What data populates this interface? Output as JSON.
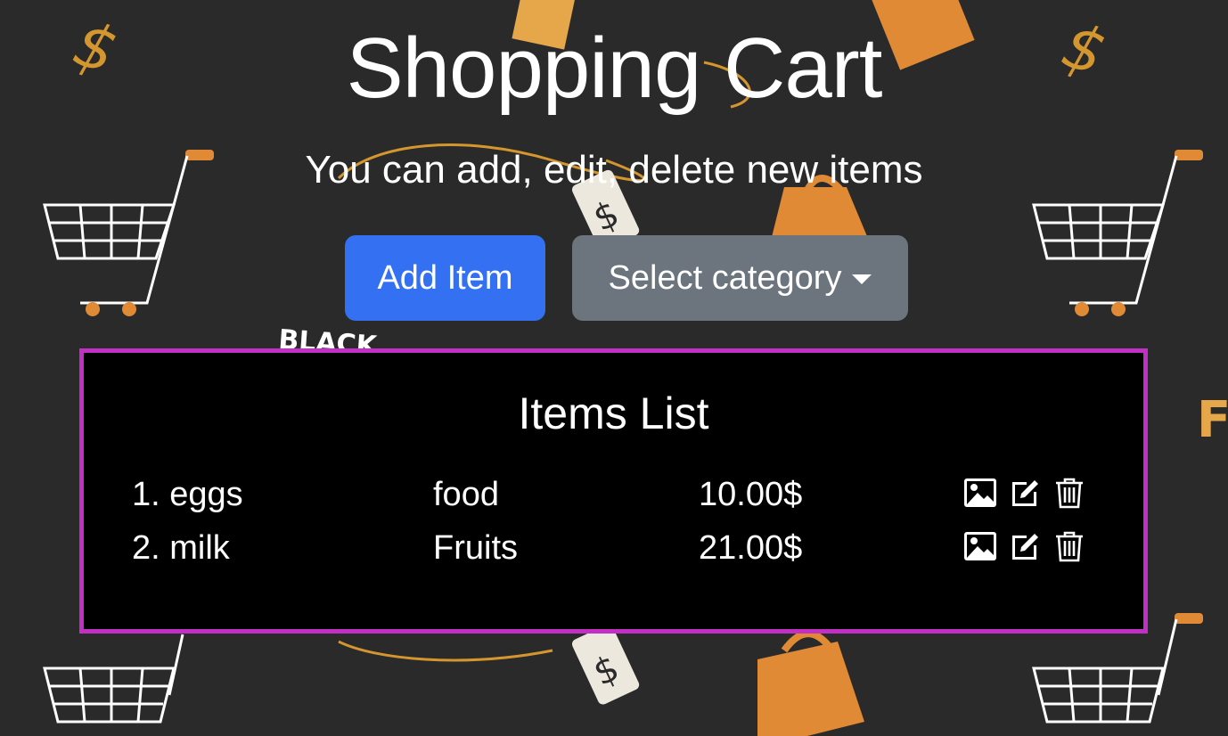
{
  "header": {
    "title": "Shopping Cart",
    "subtitle": "You can add, edit, delete new items"
  },
  "toolbar": {
    "add_label": "Add Item",
    "category_label": "Select category"
  },
  "list": {
    "title": "Items List",
    "items": [
      {
        "name": "1. eggs",
        "category": "food",
        "price": "10.00$"
      },
      {
        "name": "2. milk",
        "category": "Fruits",
        "price": "21.00$"
      }
    ]
  },
  "background": {
    "decoration_text": "BLACK"
  },
  "colors": {
    "accent": "#3371f2",
    "secondary": "#6c757d",
    "panel_border": "#c22fc4",
    "background": "#2a2a2a",
    "orange": "#e08a35"
  },
  "icons": [
    "image-icon",
    "edit-icon",
    "trash-icon"
  ]
}
